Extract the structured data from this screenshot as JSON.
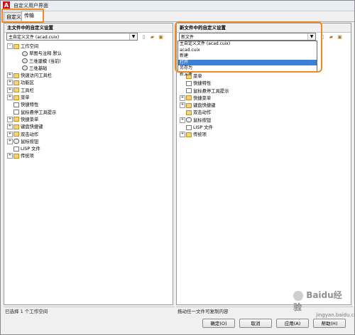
{
  "window": {
    "title": "自定义用户界面"
  },
  "tabs": [
    {
      "label": "自定义"
    },
    {
      "label": "传输"
    }
  ],
  "left_panel": {
    "header": "主文件中的自定义设置",
    "combo_value": "主自定义文件 (acad.cuix)",
    "tree": [
      {
        "label": "工作空间",
        "level": 0,
        "toggle": "-",
        "icon": "folder"
      },
      {
        "label": "草图与注释 默认",
        "level": 1,
        "toggle": "",
        "icon": "gear"
      },
      {
        "label": "三维建模 (当前)",
        "level": 1,
        "toggle": "",
        "icon": "gear"
      },
      {
        "label": "三维基础",
        "level": 1,
        "toggle": "",
        "icon": "gear"
      },
      {
        "label": "快速访问工具栏",
        "level": 0,
        "toggle": "+",
        "icon": "folder"
      },
      {
        "label": "功能区",
        "level": 0,
        "toggle": "+",
        "icon": "folder"
      },
      {
        "label": "工具栏",
        "level": 0,
        "toggle": "+",
        "icon": "folder"
      },
      {
        "label": "菜单",
        "level": 0,
        "toggle": "+",
        "icon": "folder"
      },
      {
        "label": "快捷特性",
        "level": 0,
        "toggle": "",
        "icon": "doc"
      },
      {
        "label": "鼠标悬停工具提示",
        "level": 0,
        "toggle": "",
        "icon": "doc"
      },
      {
        "label": "快捷菜单",
        "level": 0,
        "toggle": "+",
        "icon": "folder"
      },
      {
        "label": "键盘快捷键",
        "level": 0,
        "toggle": "+",
        "icon": "folder"
      },
      {
        "label": "双击动作",
        "level": 0,
        "toggle": "+",
        "icon": "folder"
      },
      {
        "label": "鼠标按钮",
        "level": 0,
        "toggle": "+",
        "icon": "mouse"
      },
      {
        "label": "LISP 文件",
        "level": 0,
        "toggle": "",
        "icon": "doc"
      },
      {
        "label": "传统项",
        "level": 0,
        "toggle": "+",
        "icon": "folder"
      }
    ],
    "status": "已选择 1 个工作空间"
  },
  "right_panel": {
    "header": "新文件中的自定义设置",
    "combo_value": "新文件",
    "dropdown_options": [
      {
        "label": "主自定义文件 (acad.cuix)",
        "selected": false
      },
      {
        "label": "acad.cuix",
        "selected": false
      },
      {
        "label": "新建",
        "selected": false
      },
      {
        "label": "打开",
        "selected": true
      },
      {
        "label": "另存为",
        "selected": false
      },
      {
        "label": "新文件",
        "selected": false
      }
    ],
    "tree": [
      {
        "label": "菜单",
        "level": 0,
        "toggle": "",
        "icon": "folder"
      },
      {
        "label": "快捷特性",
        "level": 0,
        "toggle": "",
        "icon": "doc"
      },
      {
        "label": "鼠标悬停工具提示",
        "level": 0,
        "toggle": "",
        "icon": "doc"
      },
      {
        "label": "快捷菜单",
        "level": 0,
        "toggle": "+",
        "icon": "folder"
      },
      {
        "label": "键盘快捷键",
        "level": 0,
        "toggle": "+",
        "icon": "folder"
      },
      {
        "label": "双击动作",
        "level": 0,
        "toggle": "",
        "icon": "folder"
      },
      {
        "label": "鼠标按钮",
        "level": 0,
        "toggle": "+",
        "icon": "mouse"
      },
      {
        "label": "LISP 文件",
        "level": 0,
        "toggle": "",
        "icon": "doc"
      },
      {
        "label": "传统项",
        "level": 0,
        "toggle": "+",
        "icon": "folder"
      }
    ],
    "status": "拖动任一文件可复制内容"
  },
  "buttons": {
    "ok": "确定(O)",
    "cancel": "取消",
    "apply": "应用(A)",
    "help": "帮助(H)"
  },
  "watermark": {
    "text": "Baidu经验",
    "sub": "jingyan.baidu.com"
  },
  "colors": {
    "highlight": "#f08a24",
    "selection": "#3c7fd6",
    "app_icon": "#c8141b"
  }
}
